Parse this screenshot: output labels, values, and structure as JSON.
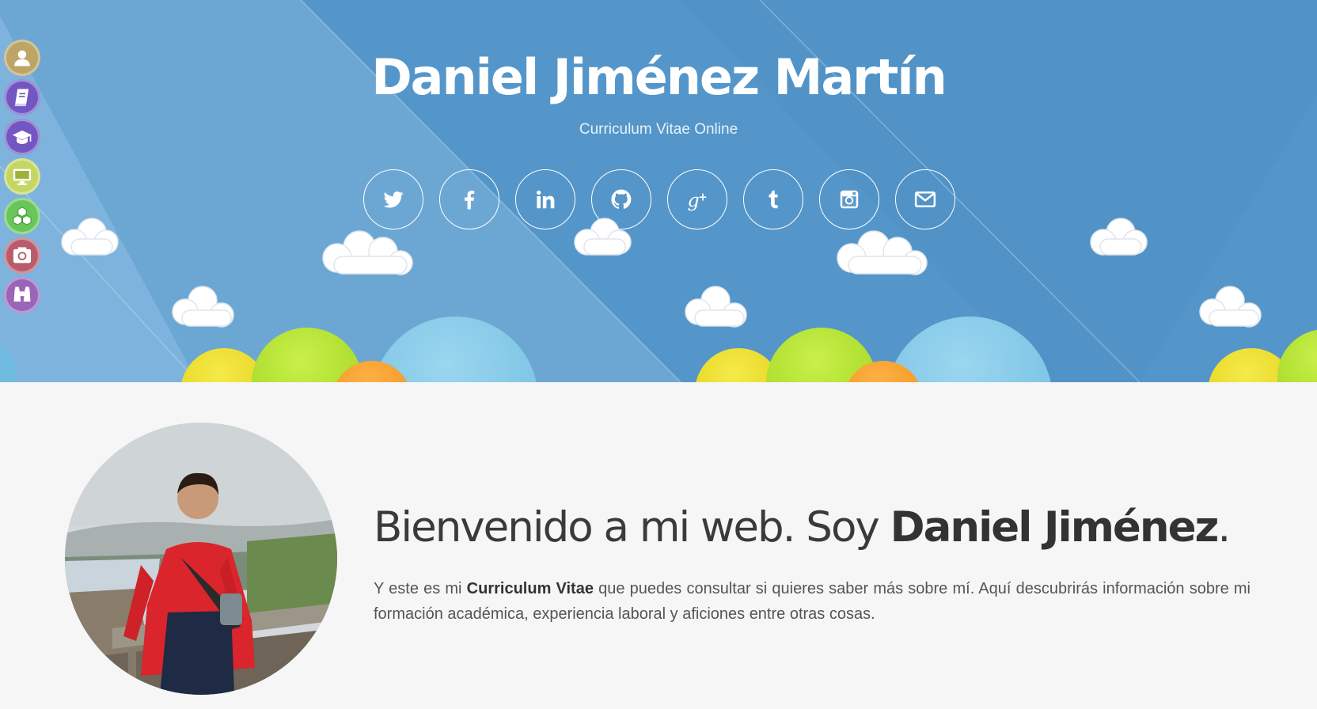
{
  "header": {
    "name": "Daniel Jiménez Martín",
    "subtitle": "Curriculum Vitae Online"
  },
  "social": [
    {
      "icon": "twitter-icon",
      "label": "Twitter"
    },
    {
      "icon": "facebook-icon",
      "label": "Facebook"
    },
    {
      "icon": "linkedin-icon",
      "label": "LinkedIn"
    },
    {
      "icon": "github-icon",
      "label": "GitHub"
    },
    {
      "icon": "google-plus-icon",
      "label": "Google+"
    },
    {
      "icon": "tumblr-icon",
      "label": "Tumblr"
    },
    {
      "icon": "instagram-icon",
      "label": "Instagram"
    },
    {
      "icon": "email-icon",
      "label": "Email"
    }
  ],
  "sidenav": [
    {
      "icon": "user-icon",
      "color": "#bda567"
    },
    {
      "icon": "book-icon",
      "color": "#7256c2"
    },
    {
      "icon": "graduation-cap-icon",
      "color": "#7256c2"
    },
    {
      "icon": "monitor-icon",
      "color": "#c5d663"
    },
    {
      "icon": "cubes-icon",
      "color": "#6bc65a"
    },
    {
      "icon": "camera-icon",
      "color": "#b85c6c"
    },
    {
      "icon": "binoculars-icon",
      "color": "#9a64b8"
    }
  ],
  "intro": {
    "heading_light": "Bienvenido a mi web. Soy ",
    "heading_bold": "Daniel Jiménez",
    "heading_end": ".",
    "text_before": "Y este es mi ",
    "text_bold": "Curriculum Vitae",
    "text_after": " que puedes consultar si quieres saber más sobre mí. Aquí descubrirás información sobre mi formación académica, experiencia laboral y aficiones entre otras cosas."
  },
  "colors": {
    "hero_blue": "#5496c9",
    "background": "#f6f6f6"
  }
}
